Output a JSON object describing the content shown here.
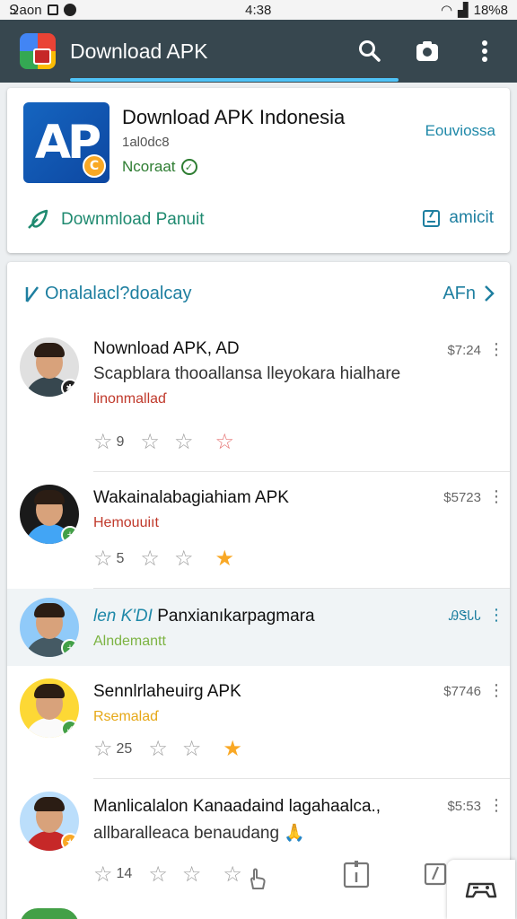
{
  "status_bar": {
    "left_text": "Ջaon",
    "time": "4:38",
    "right_text": "18%8"
  },
  "app_bar": {
    "title": "Download APK"
  },
  "hero": {
    "logo_text": "AP",
    "logo_badge": "C",
    "title": "Download APK Indonesia",
    "subtitle": "1al0dc8",
    "status": "Ncoraat",
    "right_link": "Eouviossa",
    "download_button": "Downmload Panuit",
    "secondary_button": "amicit"
  },
  "list": {
    "header_title": "Onalalacl?doalcay",
    "header_more": "AFn",
    "items": [
      {
        "title": "Nownload APK,  AD",
        "description": "Scapblara thooallansa lleyokara hialhare",
        "tag": "linonmallaɗ",
        "tag_color": "#c0392b",
        "price": "$7:24",
        "stars_count": "9",
        "last_star_color": "#e57373",
        "avatar_bg": "#e0e0e0",
        "shirt": "#37474f",
        "badge_bg": "#212121"
      },
      {
        "title": "Wakainalabagiahiam APK",
        "description": "",
        "tag": "Hemouuiıt",
        "tag_color": "#c0392b",
        "price": "$5723",
        "stars_count": "5",
        "last_star_color": "#f9a825",
        "avatar_bg": "#1a1a1a",
        "shirt": "#42a5f5",
        "badge_bg": "#43a047"
      },
      {
        "title": "Panxianıkarpagmara",
        "title_prefix": "len K'DI",
        "description": "",
        "tag": "Alndemantt",
        "tag_color": "#7cb342",
        "price": "ᎯᏕᏓᏓ",
        "stars_count": "",
        "last_star_color": "",
        "avatar_bg": "#90caf9",
        "shirt": "#455a64",
        "badge_bg": "#43a047"
      },
      {
        "title": "Sennlrlaheuirg APK",
        "description": "",
        "tag": "Rsemalaɗ",
        "tag_color": "#e6a817",
        "price": "$7746",
        "stars_count": "25",
        "last_star_color": "#f9a825",
        "avatar_bg": "#fdd835",
        "shirt": "#fafafa",
        "badge_bg": "#43a047"
      },
      {
        "title": "Manlicalalon Kanaadaind lagahaalca.,",
        "description": "allbaralleaca benaudang 🙏",
        "tag": "",
        "tag_color": "",
        "price": "$5:53",
        "stars_count": "14",
        "last_star_color": "#9e9e9e",
        "avatar_bg": "#bbdefb",
        "shirt": "#c62828",
        "badge_bg": "#f9a825"
      }
    ]
  },
  "colors": {
    "app_bar": "#37474f",
    "accent": "#4fc3f7",
    "link": "#1e7fa0",
    "green": "#2e7d32"
  },
  "icons": [
    "search-icon",
    "camera-icon",
    "more-vert-icon",
    "leaf-download-icon",
    "edit-icon",
    "chevron-right-icon",
    "star-icon",
    "touch-icon",
    "info-icon",
    "gamepad-icon"
  ]
}
